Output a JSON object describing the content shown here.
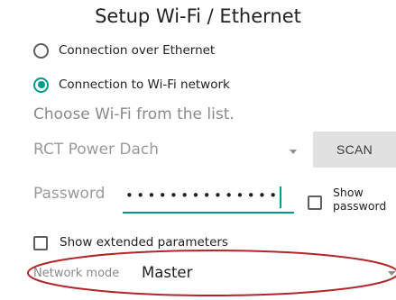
{
  "title": "Setup Wi-Fi / Ethernet",
  "connection": {
    "ethernet_label": "Connection over Ethernet",
    "wifi_label": "Connection to Wi-Fi network",
    "selected": "wifi"
  },
  "wifi": {
    "hint": "Choose Wi-Fi from the list.",
    "network": "RCT Power Dach",
    "scan_label": "SCAN"
  },
  "password": {
    "label": "Password",
    "masked_value": "••••••••••••••",
    "show_label_line1": "Show",
    "show_label_line2": "password"
  },
  "extended": {
    "label": "Show extended parameters"
  },
  "network_mode": {
    "label": "Network mode",
    "value": "Master"
  },
  "colors": {
    "accent": "#009a8a",
    "annotation": "#b1262b"
  },
  "annotation": {
    "shape": "ellipse",
    "target": "network-mode-row"
  }
}
